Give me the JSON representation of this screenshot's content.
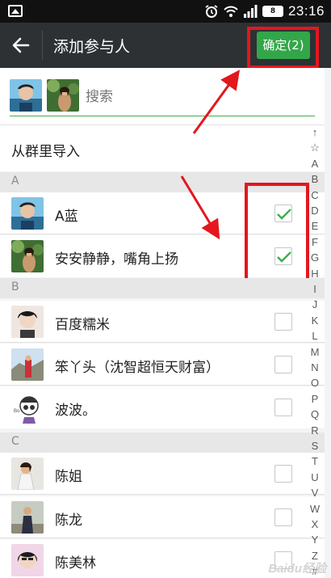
{
  "status_bar": {
    "time": "23:16",
    "battery": "8"
  },
  "header": {
    "title": "添加参与人",
    "confirm_label": "确定(2)"
  },
  "search": {
    "placeholder": "搜索"
  },
  "import": {
    "label": "从群里导入"
  },
  "sections": [
    {
      "letter": "A",
      "contacts": [
        {
          "name": "A蓝",
          "checked": true
        },
        {
          "name": "安安静静，嘴角上扬",
          "checked": true
        }
      ]
    },
    {
      "letter": "B",
      "contacts": [
        {
          "name": "百度糯米",
          "checked": false
        },
        {
          "name": "笨丫头（沈智超恒天财富）",
          "checked": false
        },
        {
          "name": "波波。",
          "checked": false
        }
      ]
    },
    {
      "letter": "C",
      "contacts": [
        {
          "name": "陈姐",
          "checked": false
        },
        {
          "name": "陈龙",
          "checked": false
        },
        {
          "name": "陈美林",
          "checked": false
        }
      ]
    }
  ],
  "index_letters": [
    "↑",
    "☆",
    "A",
    "B",
    "C",
    "D",
    "E",
    "F",
    "G",
    "H",
    "I",
    "J",
    "K",
    "L",
    "M",
    "N",
    "O",
    "P",
    "Q",
    "R",
    "S",
    "T",
    "U",
    "V",
    "W",
    "X",
    "Y",
    "Z",
    "#"
  ],
  "colors": {
    "header_bg": "#2d3134",
    "accent_green": "#33a64a",
    "annotation_red": "#e4161e"
  },
  "watermark": "Baidu经验"
}
